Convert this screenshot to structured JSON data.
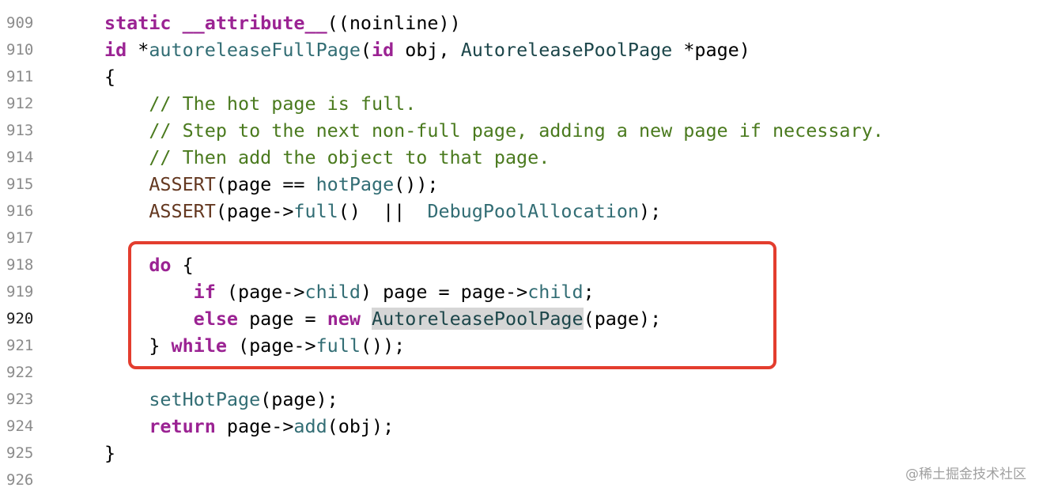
{
  "editor": {
    "line_numbers": [
      "909",
      "910",
      "911",
      "912",
      "913",
      "914",
      "915",
      "916",
      "917",
      "918",
      "919",
      "920",
      "921",
      "922",
      "923",
      "924",
      "925",
      "926"
    ],
    "current_line": "920",
    "lines": [
      [
        {
          "t": "static",
          "c": "kw"
        },
        {
          "t": " "
        },
        {
          "t": "__attribute__",
          "c": "kw"
        },
        {
          "t": "((noinline))"
        }
      ],
      [
        {
          "t": "id",
          "c": "kw"
        },
        {
          "t": " *"
        },
        {
          "t": "autoreleaseFullPage",
          "c": "fn"
        },
        {
          "t": "("
        },
        {
          "t": "id",
          "c": "kw"
        },
        {
          "t": " obj, "
        },
        {
          "t": "AutoreleasePoolPage",
          "c": "type"
        },
        {
          "t": " *page)"
        }
      ],
      [
        {
          "t": "{"
        }
      ],
      [
        {
          "t": "    // The hot page is full.",
          "c": "cmt"
        }
      ],
      [
        {
          "t": "    // Step to the next non-full page, adding a new page if necessary.",
          "c": "cmt"
        }
      ],
      [
        {
          "t": "    // Then add the object to that page.",
          "c": "cmt"
        }
      ],
      [
        {
          "t": "    "
        },
        {
          "t": "ASSERT",
          "c": "macro"
        },
        {
          "t": "(page == "
        },
        {
          "t": "hotPage",
          "c": "fn"
        },
        {
          "t": "());"
        }
      ],
      [
        {
          "t": "    "
        },
        {
          "t": "ASSERT",
          "c": "macro"
        },
        {
          "t": "(page->"
        },
        {
          "t": "full",
          "c": "fn"
        },
        {
          "t": "()  ||  "
        },
        {
          "t": "DebugPoolAllocation",
          "c": "fn"
        },
        {
          "t": ");"
        }
      ],
      [],
      [
        {
          "t": "    "
        },
        {
          "t": "do",
          "c": "kw"
        },
        {
          "t": " {"
        }
      ],
      [
        {
          "t": "        "
        },
        {
          "t": "if",
          "c": "kw"
        },
        {
          "t": " (page->"
        },
        {
          "t": "child",
          "c": "fn"
        },
        {
          "t": ") page = page->"
        },
        {
          "t": "child",
          "c": "fn"
        },
        {
          "t": ";"
        }
      ],
      [
        {
          "t": "        "
        },
        {
          "t": "else",
          "c": "kw"
        },
        {
          "t": " page = "
        },
        {
          "t": "new",
          "c": "kw"
        },
        {
          "t": " "
        },
        {
          "t": "AutoreleasePoolPage",
          "c": "type hl"
        },
        {
          "t": "(page);"
        }
      ],
      [
        {
          "t": "    } "
        },
        {
          "t": "while",
          "c": "kw"
        },
        {
          "t": " (page->"
        },
        {
          "t": "full",
          "c": "fn"
        },
        {
          "t": "());"
        }
      ],
      [],
      [
        {
          "t": "    "
        },
        {
          "t": "setHotPage",
          "c": "fn"
        },
        {
          "t": "(page);"
        }
      ],
      [
        {
          "t": "    "
        },
        {
          "t": "return",
          "c": "kw"
        },
        {
          "t": " page->"
        },
        {
          "t": "add",
          "c": "fn"
        },
        {
          "t": "(obj);"
        }
      ],
      [
        {
          "t": "}"
        }
      ],
      []
    ]
  },
  "watermark": "@稀土掘金技术社区",
  "colors": {
    "keyword": "#9b2393",
    "function": "#326d74",
    "type": "#1c464a",
    "macro": "#643820",
    "comment": "#4a7a1e",
    "highlight_box": "#e33d2e"
  }
}
